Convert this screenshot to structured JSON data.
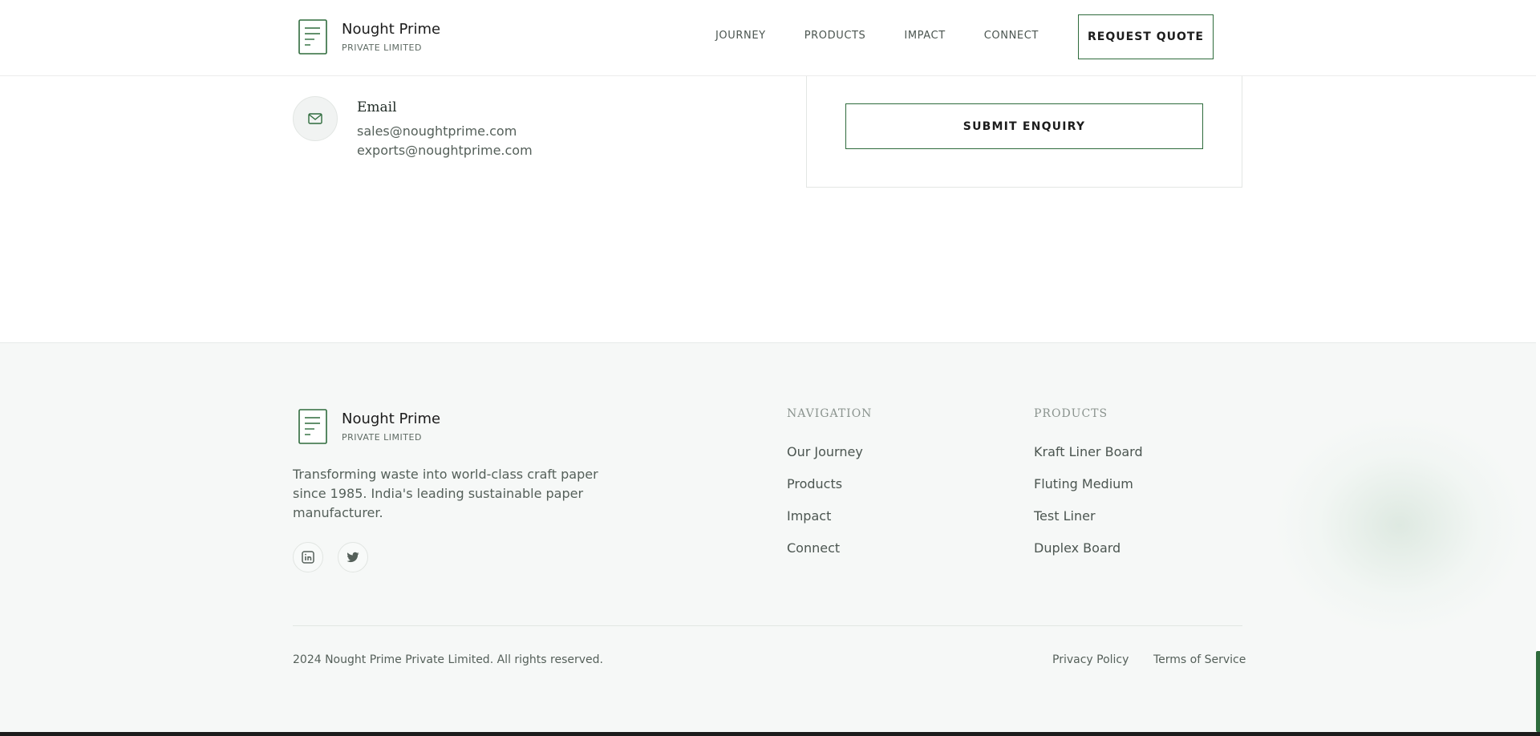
{
  "header": {
    "brand_name": "Nought Prime",
    "brand_sub": "PRIVATE LIMITED",
    "nav": [
      "JOURNEY",
      "PRODUCTS",
      "IMPACT",
      "CONNECT"
    ],
    "cta": "REQUEST QUOTE"
  },
  "contact": {
    "email_title": "Email",
    "emails": [
      "sales@noughtprime.com",
      "exports@noughtprime.com"
    ],
    "email_icon": "mail-icon",
    "submit": "SUBMIT ENQUIRY"
  },
  "footer": {
    "brand_name": "Nought Prime",
    "brand_sub": "PRIVATE LIMITED",
    "description": "Transforming waste into world-class craft paper since 1985. India's leading sustainable paper manufacturer.",
    "social": [
      "linkedin-icon",
      "twitter-icon"
    ],
    "nav_heading": "NAVIGATION",
    "nav_links": [
      "Our Journey",
      "Products",
      "Impact",
      "Connect"
    ],
    "products_heading": "PRODUCTS",
    "product_links": [
      "Kraft Liner Board",
      "Fluting Medium",
      "Test Liner",
      "Duplex Board"
    ],
    "copyright": "2024 Nought Prime Private Limited. All rights reserved.",
    "legal": [
      "Privacy Policy",
      "Terms of Service"
    ]
  },
  "colors": {
    "accent": "#2e6b3c",
    "footer_bg": "#f6f8f7",
    "text_muted": "#55605a"
  }
}
